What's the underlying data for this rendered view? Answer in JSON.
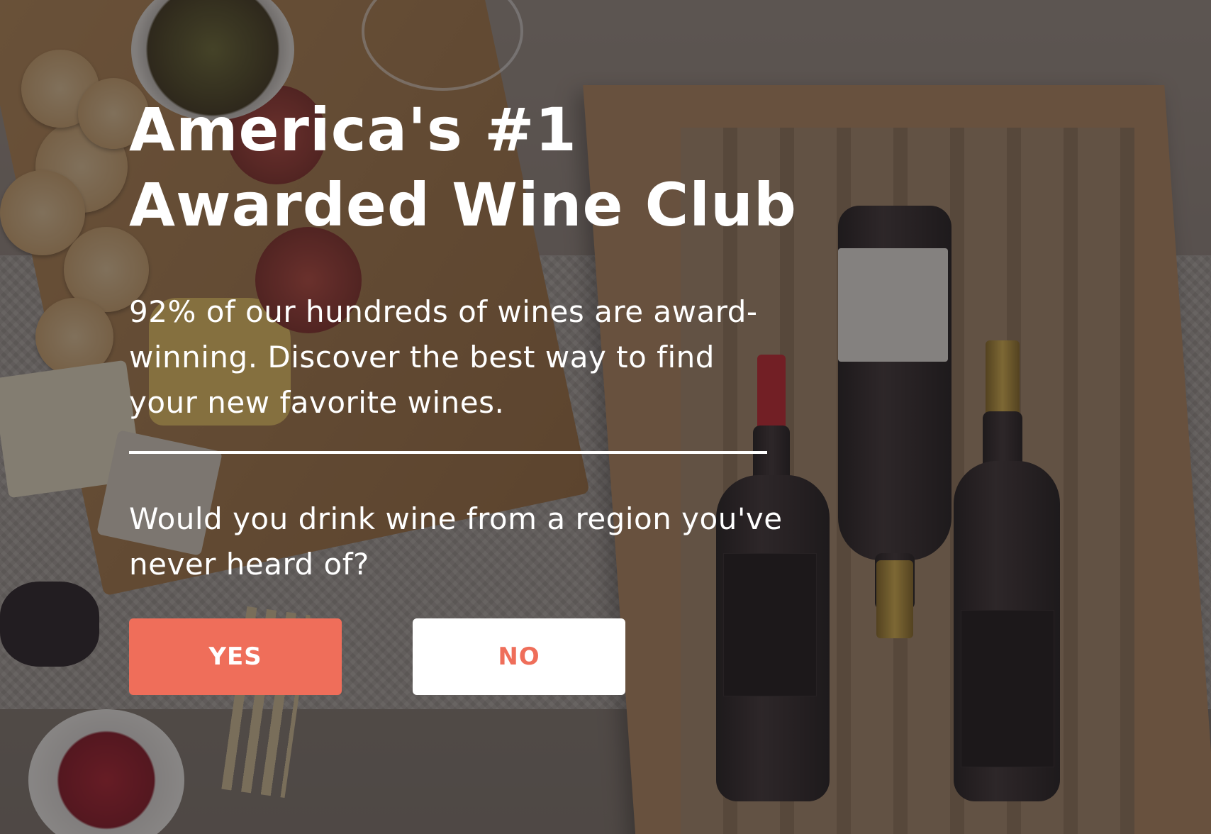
{
  "hero": {
    "headline": "America's #1\nAwarded Wine Club",
    "subtext": "92% of our hundreds of wines are award-winning. Discover the best way to find your new favorite wines.",
    "question": "Would you drink wine from a region you've never heard of?"
  },
  "buttons": {
    "yes_label": "YES",
    "no_label": "NO"
  },
  "colors": {
    "accent": "#ef6e5a",
    "text": "#ffffff",
    "overlay": "rgba(35,30,32,0.52)"
  },
  "background": {
    "description_icon": "wine-box-photo"
  }
}
